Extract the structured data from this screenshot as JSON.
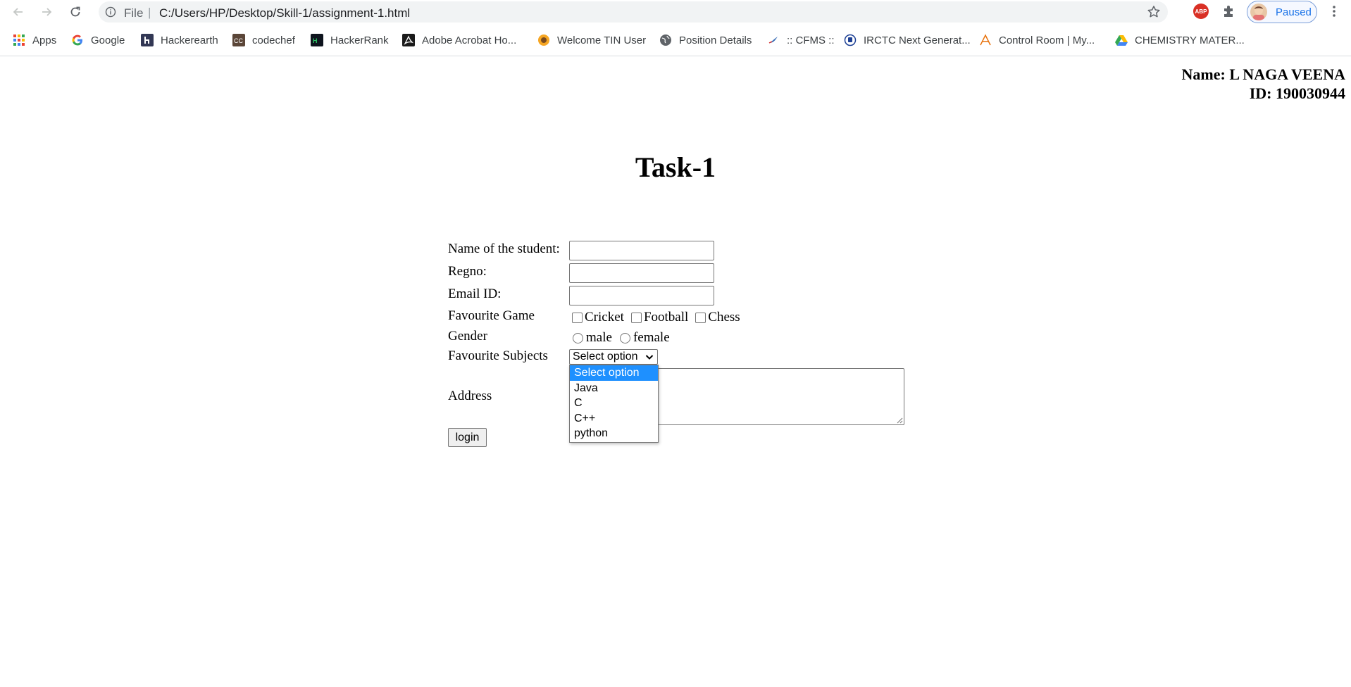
{
  "browser": {
    "url_scheme": "File",
    "url": "C:/Users/HP/Desktop/Skill-1/assignment-1.html",
    "profile_status": "Paused",
    "extension_label": "ABP",
    "bookmarks": [
      {
        "label": "Apps",
        "icon": "apps-grid-icon"
      },
      {
        "label": "Google",
        "icon": "google-icon"
      },
      {
        "label": "Hackerearth",
        "icon": "hackerearth-icon"
      },
      {
        "label": "codechef",
        "icon": "codechef-icon"
      },
      {
        "label": "HackerRank",
        "icon": "hackerrank-icon"
      },
      {
        "label": "Adobe Acrobat Ho...",
        "icon": "acrobat-icon"
      },
      {
        "label": "Welcome TIN User",
        "icon": "tin-icon"
      },
      {
        "label": "Position Details",
        "icon": "globe-icon"
      },
      {
        "label": ":: CFMS ::",
        "icon": "cfms-icon"
      },
      {
        "label": "IRCTC Next Generat...",
        "icon": "irctc-icon"
      },
      {
        "label": "Control Room | My...",
        "icon": "control-room-icon"
      },
      {
        "label": "CHEMISTRY MATER...",
        "icon": "drive-icon"
      }
    ]
  },
  "page": {
    "identity_name": "Name: L NAGA VEENA",
    "identity_id": "ID: 190030944",
    "heading": "Task-1",
    "form": {
      "name_label": "Name of the student:",
      "regno_label": "Regno:",
      "email_label": "Email ID:",
      "game_label": "Favourite Game",
      "games": [
        "Cricket",
        "Football",
        "Chess"
      ],
      "gender_label": "Gender",
      "genders": [
        "male",
        "female"
      ],
      "subjects_label": "Favourite Subjects",
      "subject_selected": "Select option",
      "subject_options": [
        "Select option",
        "Java",
        "C",
        "C++",
        "python"
      ],
      "address_label": "Address",
      "login_label": "login"
    }
  },
  "colors": {
    "highlight": "#1e90ff",
    "abp_red": "#d93025",
    "profile_blue": "#1a73e8"
  }
}
